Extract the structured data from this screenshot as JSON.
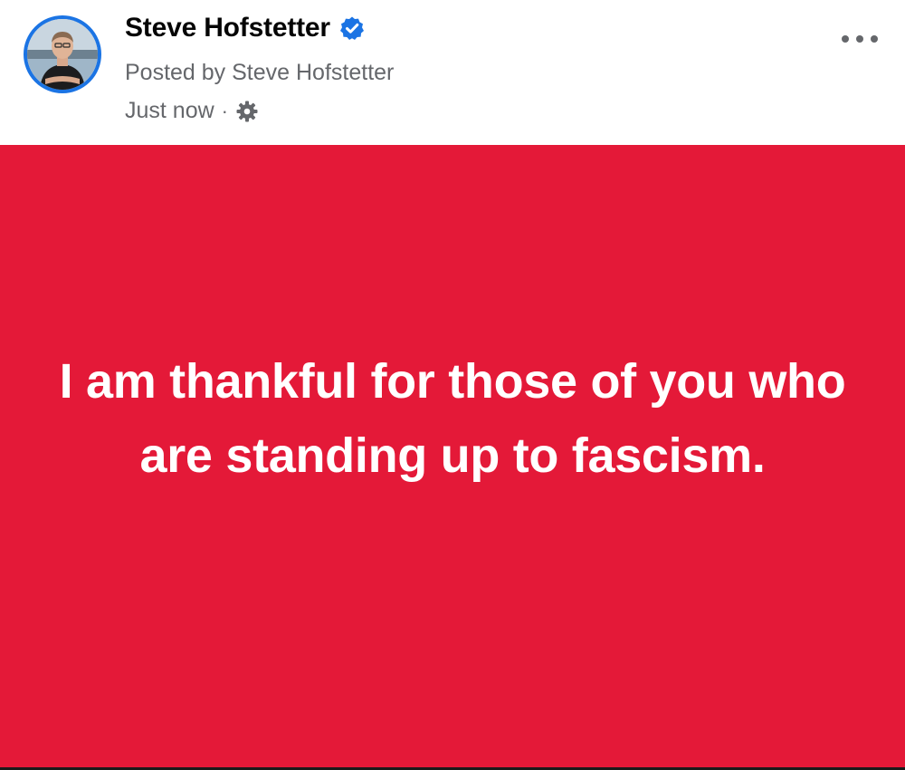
{
  "post": {
    "author_name": "Steve Hofstetter",
    "verified": true,
    "posted_by": "Posted by Steve Hofstetter",
    "timestamp": "Just now",
    "separator": "·",
    "audience_icon": "gear-icon",
    "more_icon": "more-options-icon",
    "body_text": "I am thankful for those of you who are standing up to fascism.",
    "background_color": "#e41938",
    "text_color": "#ffffff"
  },
  "colors": {
    "verified_badge": "#1b74e4",
    "secondary_text": "#65676b",
    "primary_text": "#050505"
  }
}
